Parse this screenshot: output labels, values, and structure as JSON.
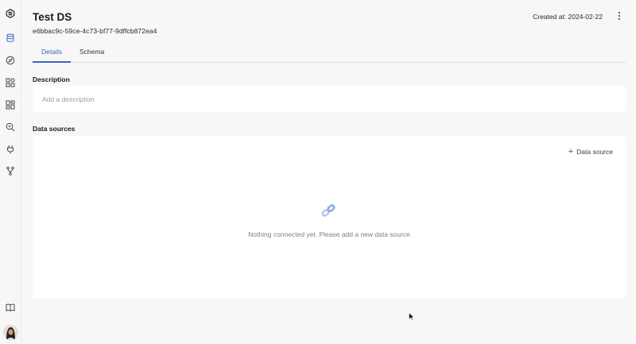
{
  "sidebar": {
    "icons": [
      "logo-icon",
      "database-icon",
      "compass-icon",
      "apps-icon",
      "dashboard-icon",
      "search-icon",
      "plug-icon",
      "fork-icon",
      "book-icon"
    ]
  },
  "header": {
    "title": "Test DS",
    "id": "e6bbac9c-59ce-4c73-bf77-9dffcb872ea4",
    "created_at": "Created at: 2024-02-22"
  },
  "tabs": [
    {
      "label": "Details",
      "active": true
    },
    {
      "label": "Schema",
      "active": false
    }
  ],
  "description": {
    "label": "Description",
    "placeholder": "Add a description"
  },
  "data_sources": {
    "label": "Data sources",
    "add_label": "Data source",
    "empty_text": "Nothing connected yet. Please add a new data source"
  },
  "colors": {
    "accent": "#3f64c4",
    "background": "#f7f7f7",
    "panel": "#ffffff"
  }
}
